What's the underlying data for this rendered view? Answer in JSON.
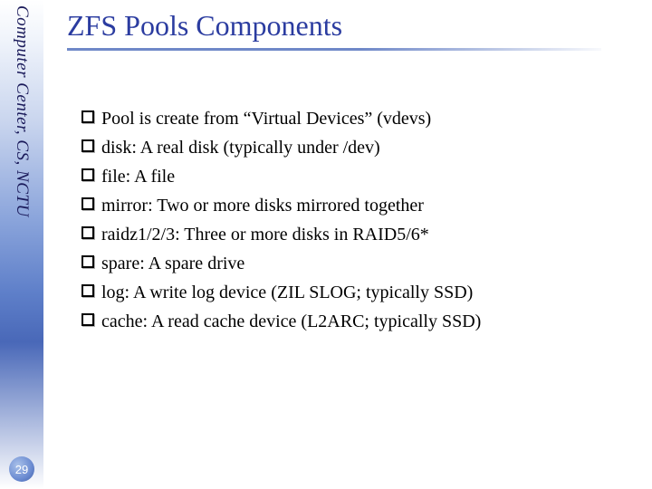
{
  "sidebar": {
    "label": "Computer Center, CS, NCTU",
    "page_number": "29"
  },
  "slide": {
    "title": "ZFS Pools Components",
    "bullets": [
      "Pool is create from “Virtual Devices” (vdevs)",
      "disk: A real disk (typically under /dev)",
      "file: A file",
      "mirror: Two or more disks mirrored together",
      "raidz1/2/3: Three or more disks in RAID5/6*",
      "spare: A spare drive",
      "log: A write log device (ZIL SLOG; typically SSD)",
      "cache: A read cache device (L2ARC; typically SSD)"
    ]
  }
}
